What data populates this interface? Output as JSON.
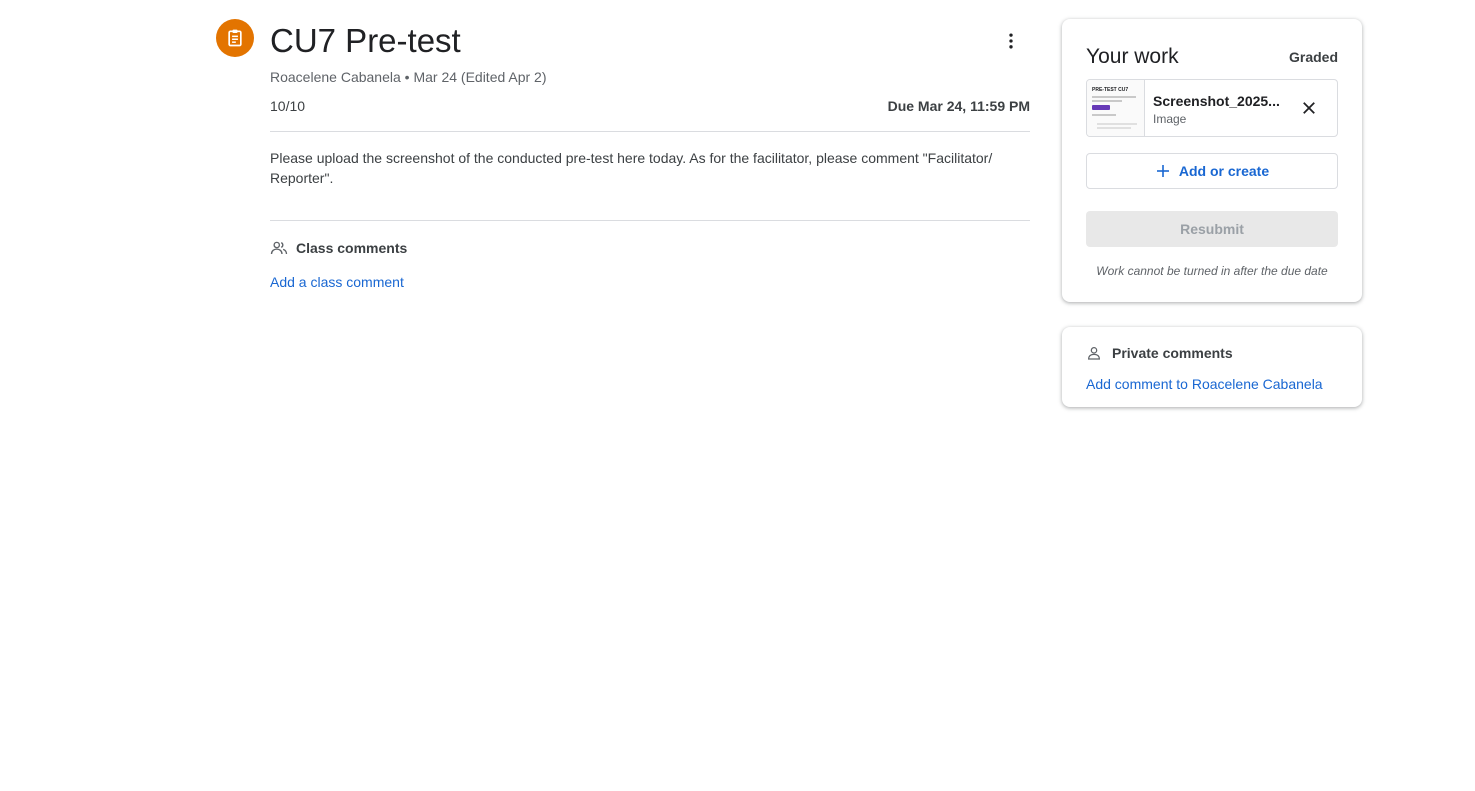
{
  "assignment": {
    "title": "CU7 Pre-test",
    "byline": "Roacelene Cabanela • Mar 24 (Edited Apr 2)",
    "points": "10/10",
    "due": "Due Mar 24, 11:59 PM",
    "instructions": "Please upload the screenshot of the conducted pre-test here today. As for the facilitator, please comment \"Facilitator/ Reporter\".",
    "icon": "assignment-icon",
    "icon_color": "#e37400"
  },
  "class_comments": {
    "label": "Class comments",
    "add_label": "Add a class comment",
    "icon": "people-icon"
  },
  "your_work": {
    "title": "Your work",
    "status": "Graded",
    "attachment": {
      "name": "Screenshot_2025...",
      "type": "Image",
      "thumbnail_title": "PRE-TEST CU7"
    },
    "add_or_create_label": "Add or create",
    "resubmit_label": "Resubmit",
    "note": "Work cannot be turned in after the due date"
  },
  "private_comments": {
    "label": "Private comments",
    "add_label": "Add comment to Roacelene Cabanela",
    "icon": "person-icon"
  },
  "colors": {
    "link": "#1967d2",
    "accent_orange": "#e37400",
    "divider": "#dadce0"
  }
}
